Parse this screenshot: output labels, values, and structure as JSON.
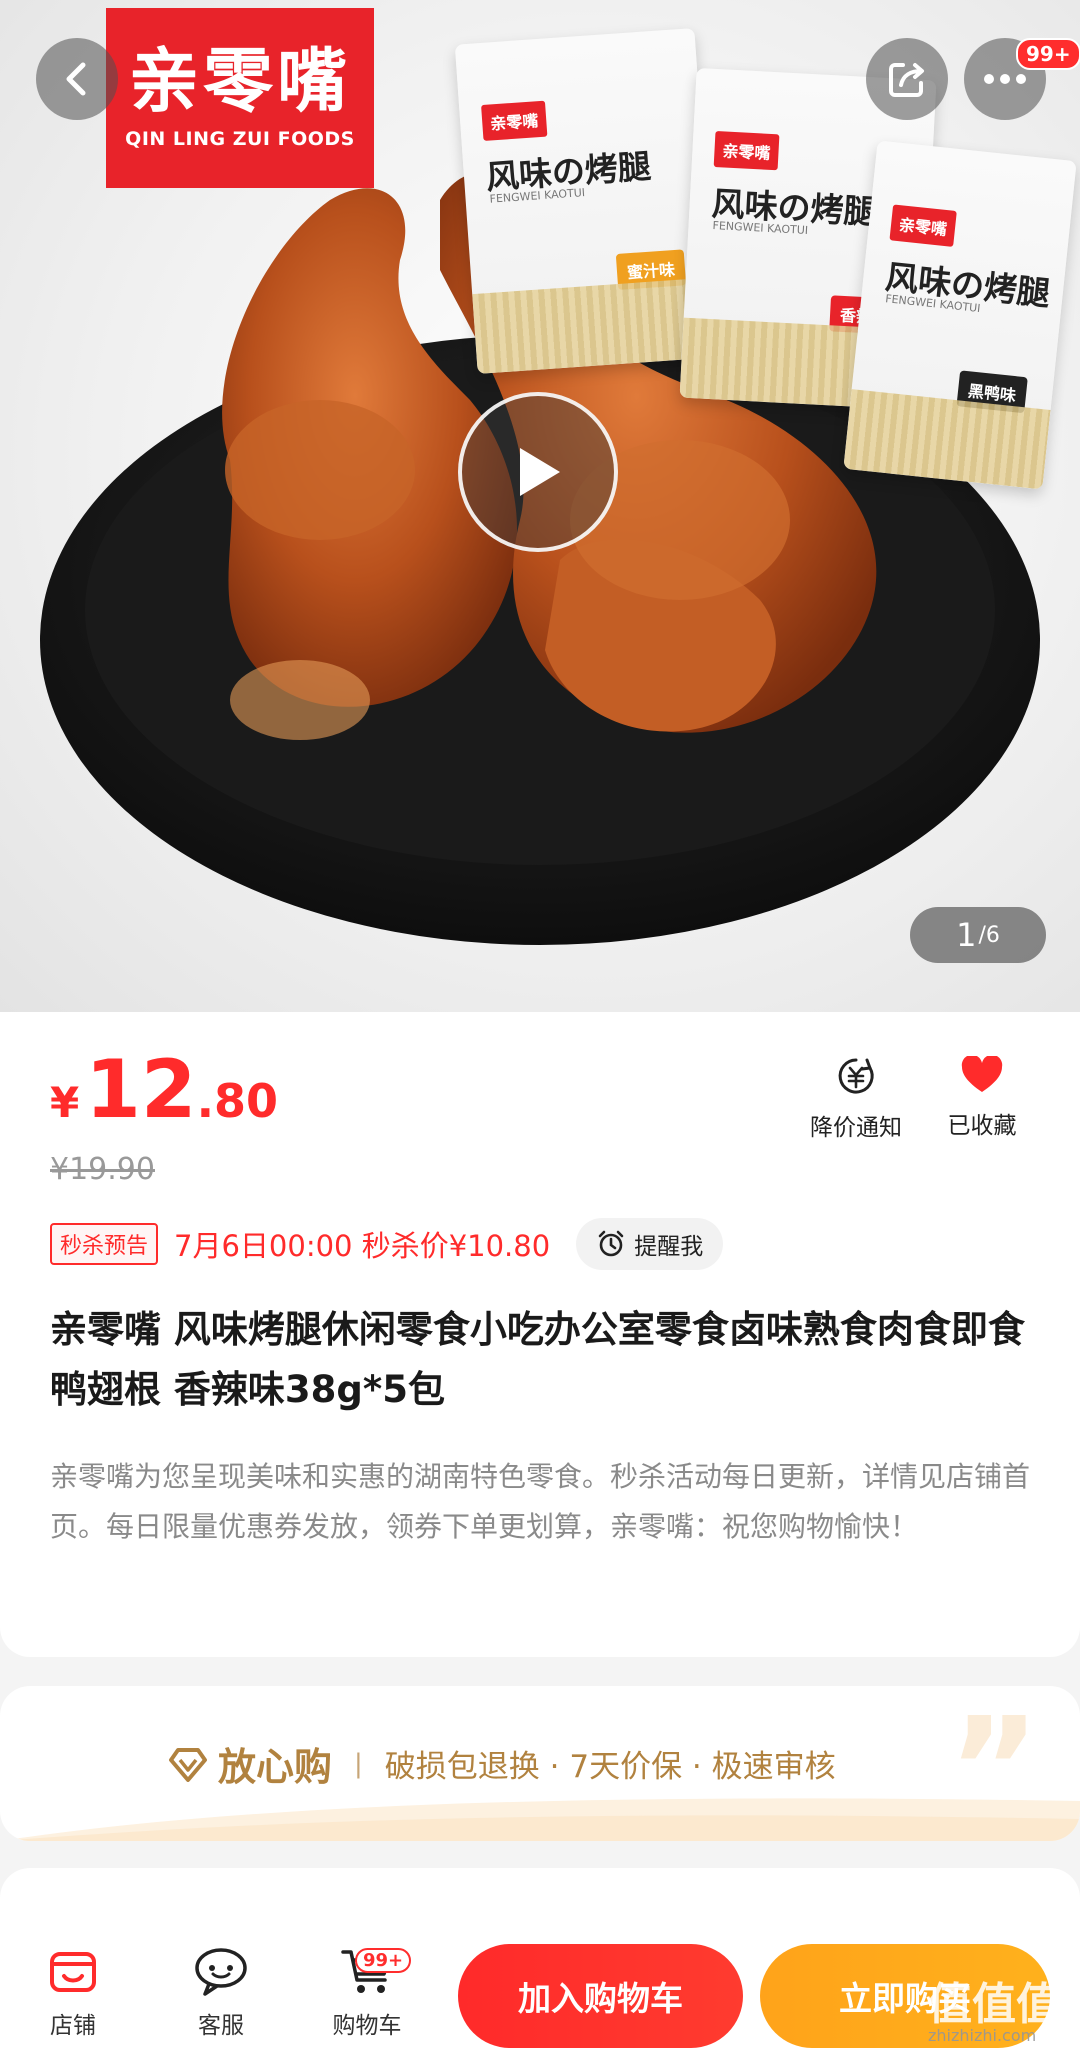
{
  "hero": {
    "brand_logo": {
      "cn": "亲零嘴",
      "en": "QIN LING ZUI FOODS"
    },
    "packages": [
      {
        "brand": "亲零嘴",
        "name": "风味の烤腿",
        "pinyin": "FENGWEI KAOTUI",
        "flavor": "蜜汁味",
        "flavor_color": "#f0a020"
      },
      {
        "brand": "亲零嘴",
        "name": "风味の烤腿",
        "pinyin": "FENGWEI KAOTUI",
        "flavor": "香辣味",
        "flavor_color": "#e8232a"
      },
      {
        "brand": "亲零嘴",
        "name": "风味の烤腿",
        "pinyin": "FENGWEI KAOTUI",
        "flavor": "黑鸭味",
        "flavor_color": "#222222"
      }
    ],
    "notification_badge": "99+",
    "image_counter": {
      "current": "1",
      "total": "/6"
    }
  },
  "product": {
    "price": {
      "currency": "¥",
      "integer": "12",
      "decimal": ".80"
    },
    "original_price": "¥19.90",
    "actions": [
      {
        "label": "降价通知",
        "icon": "price-drop-alert-icon"
      },
      {
        "label": "已收藏",
        "icon": "heart-filled-icon"
      }
    ],
    "flash_sale": {
      "tag": "秒杀预告",
      "time_text": "7月6日00:00 秒杀价¥10.80",
      "remind_label": "提醒我"
    },
    "title": "亲零嘴 风味烤腿休闲零食小吃办公室零食卤味熟食肉食即食鸭翅根 香辣味38g*5包",
    "description": "亲零嘴为您呈现美味和实惠的湖南特色零食。秒杀活动每日更新，详情见店铺首页。每日限量优惠券发放，领券下单更划算，亲零嘴：祝您购物愉快！"
  },
  "assurance": {
    "brand": "放心购",
    "separator": "|",
    "items": "破损包退换 · 7天价保 · 极速审核"
  },
  "bottom_bar": {
    "tabs": [
      {
        "label": "店铺",
        "icon": "store-icon"
      },
      {
        "label": "客服",
        "icon": "customer-service-icon"
      },
      {
        "label": "购物车",
        "icon": "cart-icon"
      }
    ],
    "cart_badge": "99+",
    "add_to_cart": "加入购物车",
    "buy_now": "立即购买"
  },
  "watermark": {
    "text": "值值值",
    "url": "zhizhizhi.com"
  },
  "colors": {
    "price_red": "#ff2b2b",
    "brand_red": "#e8232a",
    "buy_orange": "#ffa31a",
    "assurance_gold": "#b1823f"
  }
}
